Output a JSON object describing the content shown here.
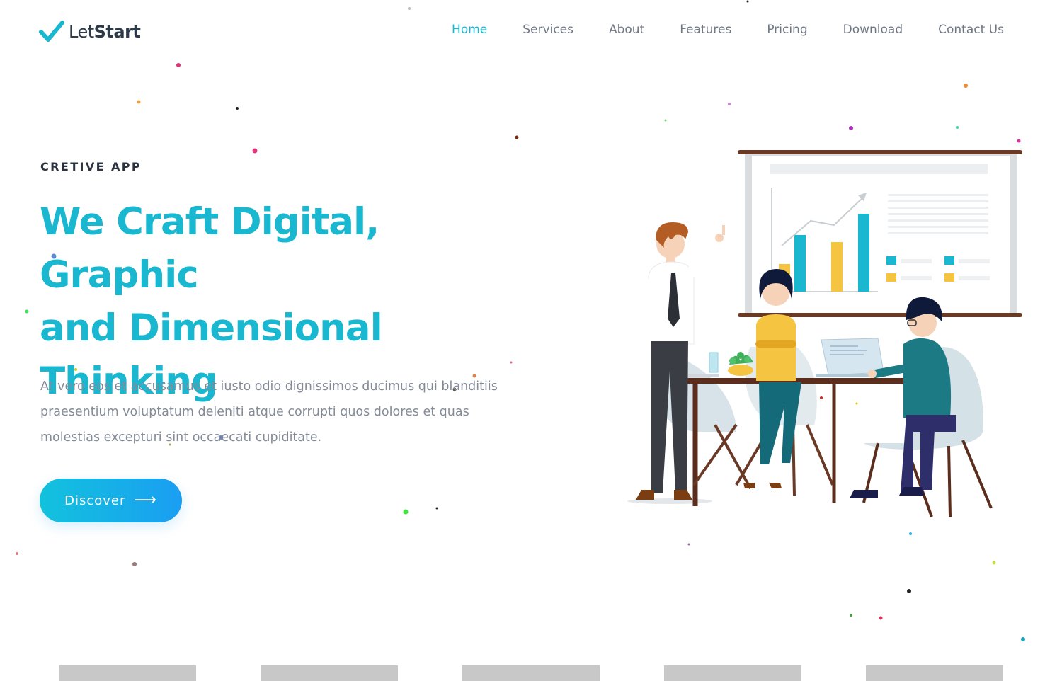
{
  "brand": {
    "name_light": "Let",
    "name_bold": "Start",
    "logo_icon": "check-icon",
    "accent": "#19b7d0"
  },
  "nav": {
    "items": [
      {
        "label": "Home",
        "active": true
      },
      {
        "label": "Services",
        "active": false
      },
      {
        "label": "About",
        "active": false
      },
      {
        "label": "Features",
        "active": false
      },
      {
        "label": "Pricing",
        "active": false
      },
      {
        "label": "Download",
        "active": false
      },
      {
        "label": "Contact Us",
        "active": false
      }
    ]
  },
  "hero": {
    "eyebrow": "CRETIVE APP",
    "headline_line1": "We Craft Digital, Graphic",
    "headline_line2": "and Dimensional",
    "headline_line3": "Thinking",
    "paragraph_line1": "At vero eos et accusamus et iusto odio dignissimos ducimus qui blanditiis",
    "paragraph_line2": "praesentium voluptatum deleniti atque corrupti quos dolores et quas",
    "paragraph_line3": "molestias excepturi sint occaecati cupiditate.",
    "cta_label": "Discover",
    "cta_icon": "arrow-right-icon"
  },
  "colors": {
    "heading": "#19b7d0",
    "text_muted": "#848b98",
    "nav_text": "#707784",
    "cta_gradient_start": "#12c2dd",
    "cta_gradient_end": "#1a9ef2"
  }
}
